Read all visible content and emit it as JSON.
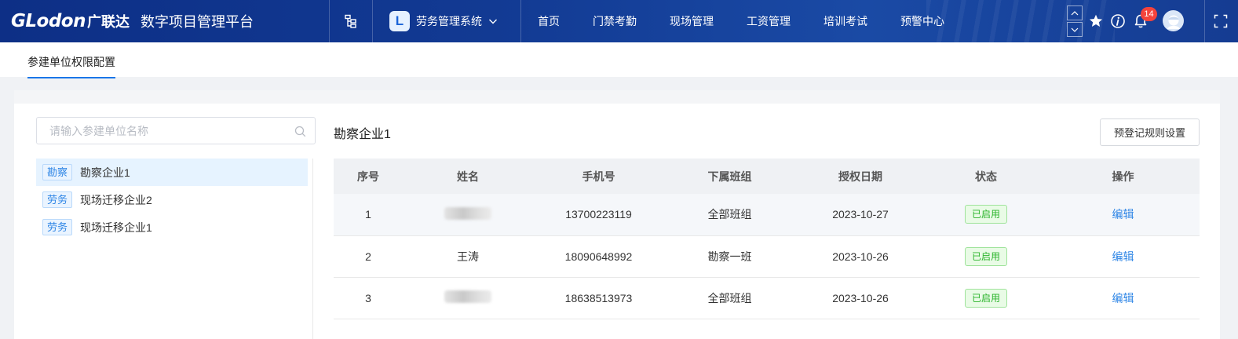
{
  "header": {
    "brand": "GLodon",
    "brand_cn": "广联达",
    "platform_name": "数字项目管理平台",
    "system_logo_letter": "L",
    "system_name": "劳务管理系统",
    "nav": [
      "首页",
      "门禁考勤",
      "现场管理",
      "工资管理",
      "培训考试",
      "预警中心"
    ],
    "notification_count": "14",
    "bg_color": "#123a93"
  },
  "tabbar": {
    "active_tab": "参建单位权限配置"
  },
  "sidebar": {
    "search_placeholder": "请输入参建单位名称",
    "items": [
      {
        "tag": "勘察",
        "name": "勘察企业1",
        "active": true
      },
      {
        "tag": "劳务",
        "name": "现场迁移企业2",
        "active": false
      },
      {
        "tag": "劳务",
        "name": "现场迁移企业1",
        "active": false
      }
    ]
  },
  "detail": {
    "title": "勘察企业1",
    "rule_button": "预登记规则设置",
    "columns": [
      "序号",
      "姓名",
      "手机号",
      "下属班组",
      "授权日期",
      "状态",
      "操作"
    ],
    "rows": [
      {
        "index": "1",
        "name": "",
        "name_blurred": true,
        "phone": "13700223119",
        "team": "全部班组",
        "date": "2023-10-27",
        "status": "已启用",
        "action": "编辑"
      },
      {
        "index": "2",
        "name": "王涛",
        "name_blurred": false,
        "phone": "18090648992",
        "team": "勘察一班",
        "date": "2023-10-26",
        "status": "已启用",
        "action": "编辑"
      },
      {
        "index": "3",
        "name": "",
        "name_blurred": true,
        "phone": "18638513973",
        "team": "全部班组",
        "date": "2023-10-26",
        "status": "已启用",
        "action": "编辑"
      }
    ]
  },
  "colors": {
    "accent": "#1a76e8",
    "status_green": "#2db52d",
    "link_blue": "#2f86e6"
  }
}
